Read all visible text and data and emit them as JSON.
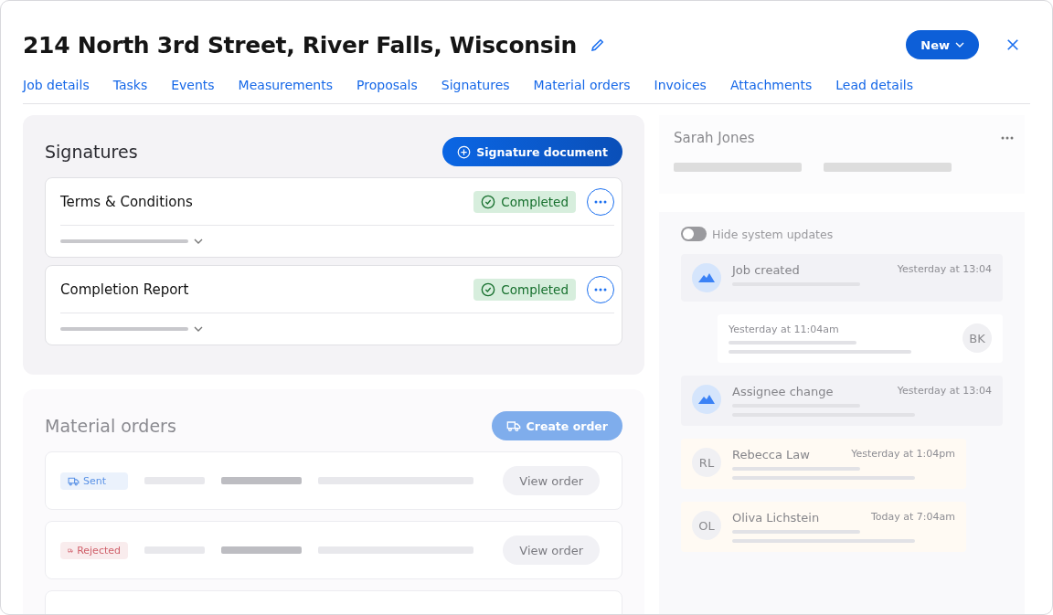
{
  "title": "214 North 3rd Street, River Falls, Wisconsin",
  "new_button": "New",
  "tabs": [
    {
      "label": "Job details",
      "selected": false
    },
    {
      "label": "Tasks",
      "selected": false
    },
    {
      "label": "Events",
      "selected": false
    },
    {
      "label": "Measurements",
      "selected": false
    },
    {
      "label": "Proposals",
      "selected": false
    },
    {
      "label": "Signatures",
      "selected": false
    },
    {
      "label": "Material orders",
      "selected": false
    },
    {
      "label": "Invoices",
      "selected": false
    },
    {
      "label": "Attachments",
      "selected": false
    },
    {
      "label": "Lead details",
      "selected": false
    }
  ],
  "signatures": {
    "title": "Signatures",
    "button": "Signature document",
    "documents": [
      {
        "name": "Terms & Conditions",
        "status": "Completed"
      },
      {
        "name": "Completion Report",
        "status": "Completed"
      }
    ]
  },
  "material_orders": {
    "title": "Material orders",
    "button": "Create order",
    "orders": [
      {
        "kind": "order",
        "status": "Sent",
        "color": "#5b93e6",
        "action": "View order"
      },
      {
        "kind": "order",
        "status": "Rejected",
        "color": "#cf5f69",
        "action": "View order"
      },
      {
        "kind": "blank"
      }
    ]
  },
  "contact": {
    "name": "Sarah Jones"
  },
  "activity": {
    "toggle": {
      "label": "Hide system updates",
      "on": false
    },
    "items": [
      {
        "kind": "system",
        "title": "Job created",
        "time": "Yesterday at 13:04"
      },
      {
        "kind": "note",
        "time": "Yesterday at 11:04am",
        "initials": "BK"
      },
      {
        "kind": "system",
        "title": "Assignee change",
        "time": "Yesterday at 13:04"
      },
      {
        "kind": "comment",
        "title": "Rebecca Law",
        "time": "Yesterday at 1:04pm",
        "initials": "RL"
      },
      {
        "kind": "comment",
        "title": "Oliva Lichstein",
        "time": "Today at 7:04am",
        "initials": "OL"
      }
    ]
  }
}
